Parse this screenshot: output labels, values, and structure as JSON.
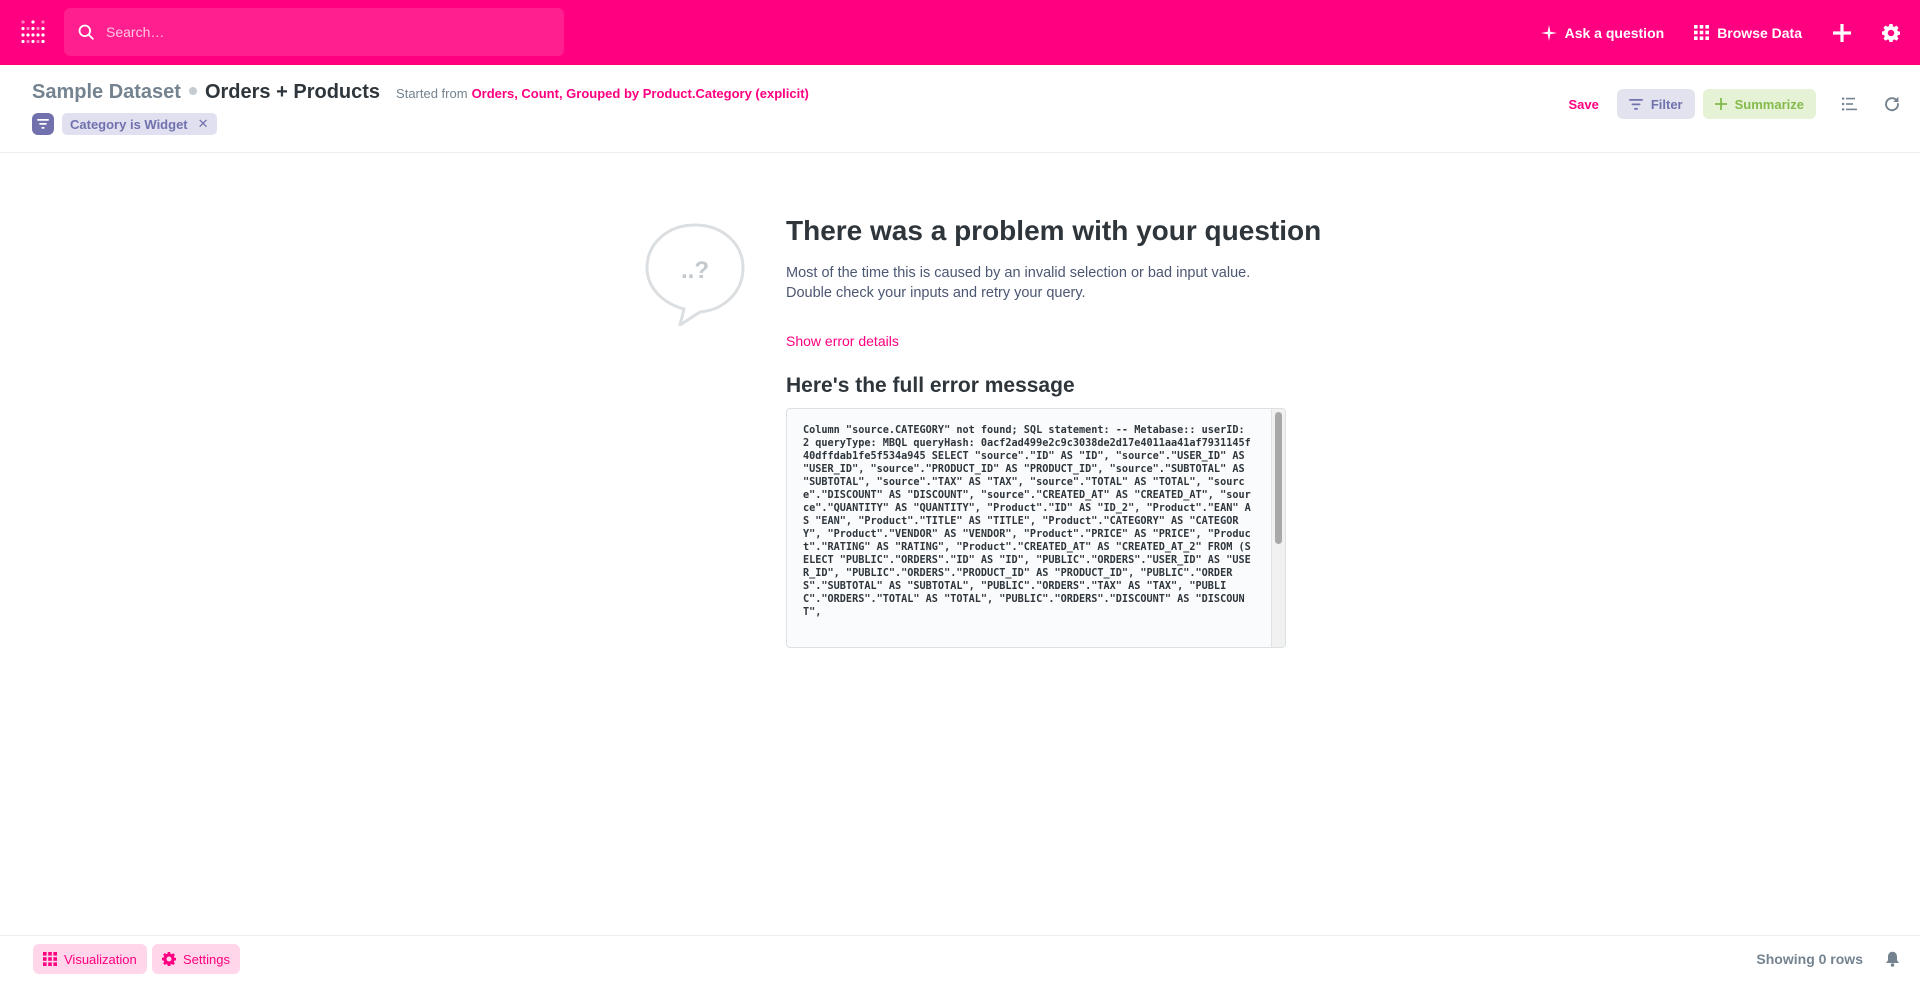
{
  "topnav": {
    "search_placeholder": "Search…",
    "ask_question_label": "Ask a question",
    "browse_data_label": "Browse Data",
    "brand_color": "#ff0080",
    "icons": [
      "metabase-logo-icon",
      "search-icon",
      "sparkle-icon",
      "grid-icon",
      "plus-icon",
      "gear-icon"
    ]
  },
  "header": {
    "database_name": "Sample Dataset",
    "table_name": "Orders + Products",
    "started_from_label": "Started from",
    "started_from_link": "Orders, Count, Grouped by Product.Category (explicit)",
    "filter_pill_label": "Category is Widget",
    "filter_pill_remove": "✕",
    "save_label": "Save",
    "filter_label": "Filter",
    "summarize_label": "Summarize"
  },
  "error": {
    "bubble_text": "..?",
    "title": "There was a problem with your question",
    "description": "Most of the time this is caused by an invalid selection or bad input value. Double check your inputs and retry your query.",
    "show_details_label": "Show error details",
    "full_message_title": "Here's the full error message",
    "message": "Column \"source.CATEGORY\" not found; SQL statement: -- Metabase:: userID: 2 queryType: MBQL queryHash: 0acf2ad499e2c9c3038de2d17e4011aa41af7931145f40dffdab1fe5f534a945 SELECT \"source\".\"ID\" AS \"ID\", \"source\".\"USER_ID\" AS \"USER_ID\", \"source\".\"PRODUCT_ID\" AS \"PRODUCT_ID\", \"source\".\"SUBTOTAL\" AS \"SUBTOTAL\", \"source\".\"TAX\" AS \"TAX\", \"source\".\"TOTAL\" AS \"TOTAL\", \"source\".\"DISCOUNT\" AS \"DISCOUNT\", \"source\".\"CREATED_AT\" AS \"CREATED_AT\", \"source\".\"QUANTITY\" AS \"QUANTITY\", \"Product\".\"ID\" AS \"ID_2\", \"Product\".\"EAN\" AS \"EAN\", \"Product\".\"TITLE\" AS \"TITLE\", \"Product\".\"CATEGORY\" AS \"CATEGORY\", \"Product\".\"VENDOR\" AS \"VENDOR\", \"Product\".\"PRICE\" AS \"PRICE\", \"Product\".\"RATING\" AS \"RATING\", \"Product\".\"CREATED_AT\" AS \"CREATED_AT_2\" FROM (SELECT \"PUBLIC\".\"ORDERS\".\"ID\" AS \"ID\", \"PUBLIC\".\"ORDERS\".\"USER_ID\" AS \"USER_ID\", \"PUBLIC\".\"ORDERS\".\"PRODUCT_ID\" AS \"PRODUCT_ID\", \"PUBLIC\".\"ORDERS\".\"SUBTOTAL\" AS \"SUBTOTAL\", \"PUBLIC\".\"ORDERS\".\"TAX\" AS \"TAX\", \"PUBLIC\".\"ORDERS\".\"TOTAL\" AS \"TOTAL\", \"PUBLIC\".\"ORDERS\".\"DISCOUNT\" AS \"DISCOUNT\","
  },
  "footer": {
    "visualization_label": "Visualization",
    "settings_label": "Settings",
    "row_count_text": "Showing 0 rows"
  }
}
